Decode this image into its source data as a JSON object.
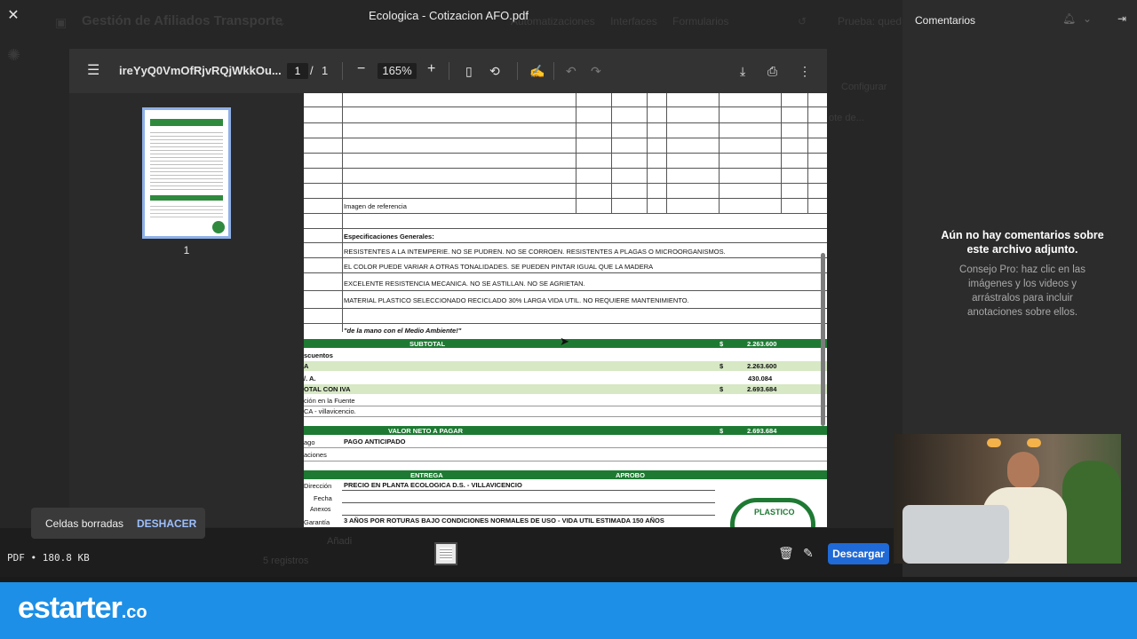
{
  "background": {
    "app_title": "Gestión de Afiliados Transporte",
    "tabs": [
      "Automatizaciones",
      "Interfaces",
      "Formularios"
    ],
    "trial_label": "Prueba: qued",
    "configure_label": "Configurar",
    "side_text": "ote de...",
    "records_label": "5 registros",
    "add_label": "Añadi"
  },
  "window": {
    "title": "Ecologica - Cotizacion AFO.pdf"
  },
  "viewer": {
    "file_name": "ireYyQ0VmOfRjvRQjWkkOu...",
    "page_current": "1",
    "page_separator": "/",
    "page_total": "1",
    "zoom": "165%",
    "thumbnail_label": "1"
  },
  "document": {
    "image_label": "Imagen de referencia",
    "specs_heading": "Especificaciones Generales:",
    "specs": [
      "RESISTENTES A LA INTEMPERIE.  NO SE PUDREN.  NO SE CORROEN.  RESISTENTES A PLAGAS O MICROORGANISMOS.",
      "EL COLOR PUEDE VARIAR A OTRAS TONALIDADES.  SE PUEDEN PINTAR IGUAL QUE LA MADERA",
      "EXCELENTE RESISTENCIA MECANICA. NO SE ASTILLAN.  NO SE AGRIETAN.",
      "MATERIAL PLASTICO SELECCIONADO RECICLADO 30% LARGA VIDA UTIL.  NO REQUIERE MANTENIMIENTO."
    ],
    "slogan": "\"de la mano con el Medio Ambiente!\"",
    "subtotal_label": "SUBTOTAL",
    "currency": "$",
    "subtotal_value": "2.263.600",
    "discounts_label": "scuentos",
    "row_a_label": "A",
    "row_a_value": "2.263.600",
    "iva_label": "/. A.",
    "iva_value": "430.084",
    "total_label": "OTAL CON IVA",
    "total_value": "2.693.684",
    "retention_label": "ción en la Fuente",
    "ica_label": "CA - villavicencio.",
    "net_label": "VALOR NETO A PAGAR",
    "net_value": "2.693.684",
    "payment_label": "ago",
    "payment_value": "PAGO ANTICIPADO",
    "notes_label": "aciones",
    "delivery_label": "ENTREGA",
    "approve_label": "APROBO",
    "address_label": "Dirección",
    "address_value": "PRECIO EN PLANTA ECOLOGICA D.S. - VILLAVICENCIO",
    "date_label": "Fecha",
    "annex_label": "Anexos",
    "warranty_label": "Garantía",
    "warranty_value": "3 AÑOS POR ROTURAS BAJO CONDICIONES NORMALES DE USO - VIDA UTIL ESTIMADA 150 AÑOS",
    "seal_text": "PLASTICO"
  },
  "comments": {
    "title": "Comentarios",
    "empty_title": "Aún no hay comentarios sobre este archivo adjunto.",
    "tip": "Consejo Pro: haz clic en las imágenes y los videos y arrástralos para incluir anotaciones sobre ellos."
  },
  "footer": {
    "file_info": "PDF • 180.8 KB",
    "download_label": "Descargar"
  },
  "toast": {
    "message": "Celdas borradas",
    "undo_label": "DESHACER"
  },
  "brand": {
    "name": "estarter",
    "suffix": ".co"
  },
  "colors": {
    "accent": "#1f6ad6",
    "doc_green": "#1e7a33",
    "doc_light_green": "#d6e8c4",
    "brand_blue": "#1d8fe6"
  }
}
